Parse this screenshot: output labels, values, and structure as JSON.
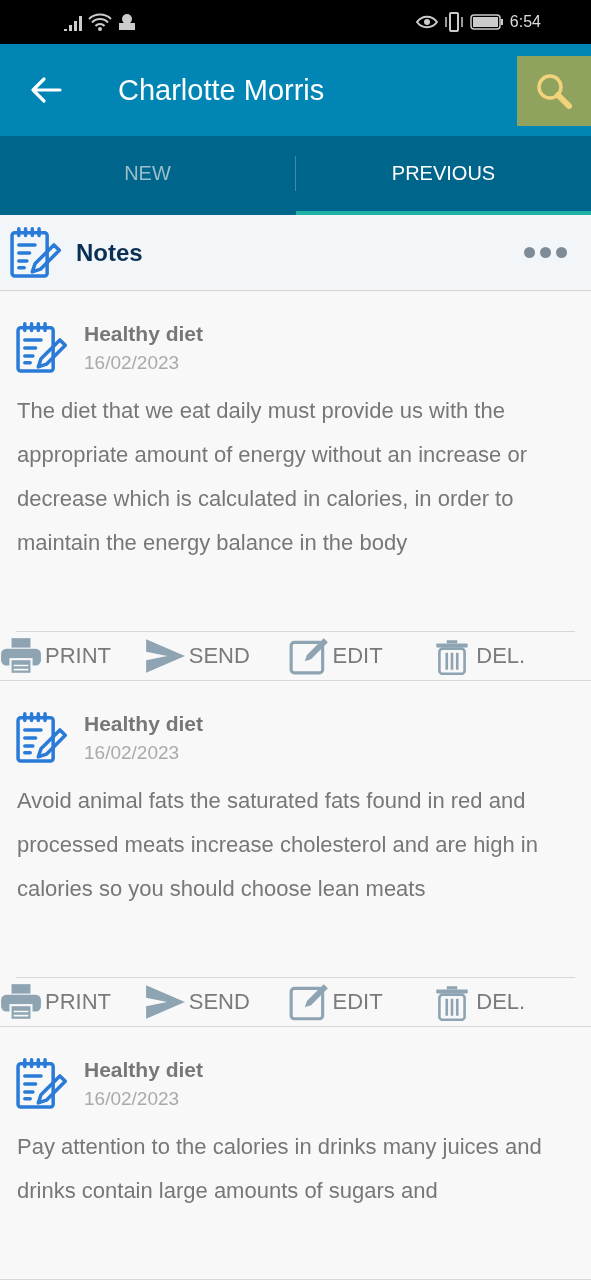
{
  "status_bar": {
    "time": "6:54"
  },
  "app_bar": {
    "title": "Charlotte Morris"
  },
  "tabs": [
    {
      "label": "NEW",
      "selected": false
    },
    {
      "label": "PREVIOUS",
      "selected": true
    }
  ],
  "section": {
    "title": "Notes"
  },
  "notes": [
    {
      "title": "Healthy diet",
      "date": "16/02/2023",
      "body": "The diet that we eat daily must provide us with the appropriate amount of energy without an increase or decrease which is calculated in calories, in order to maintain the energy balance in the body",
      "actions": [
        {
          "kind": "print",
          "label": "PRINT"
        },
        {
          "kind": "send",
          "label": "SEND"
        },
        {
          "kind": "edit",
          "label": "EDIT"
        },
        {
          "kind": "delete",
          "label": "DEL."
        }
      ]
    },
    {
      "title": "Healthy diet",
      "date": "16/02/2023",
      "body": "Avoid animal fats the saturated fats found in red and processed meats increase cholesterol and are high in calories so you should choose lean meats",
      "actions": [
        {
          "kind": "print",
          "label": "PRINT"
        },
        {
          "kind": "send",
          "label": "SEND"
        },
        {
          "kind": "edit",
          "label": "EDIT"
        },
        {
          "kind": "delete",
          "label": "DEL."
        }
      ]
    },
    {
      "title": "Healthy diet",
      "date": "16/02/2023",
      "body": "Pay attention to the calories in drinks many juices and drinks contain large amounts of sugars and"
    }
  ]
}
